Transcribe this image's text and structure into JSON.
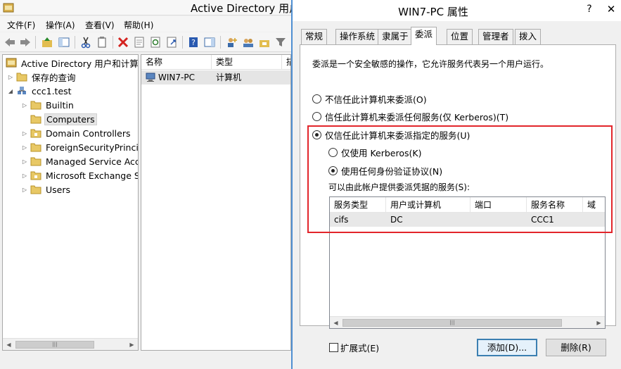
{
  "aduc": {
    "title": "Active Directory 用户",
    "menu": [
      "文件(F)",
      "操作(A)",
      "查看(V)",
      "帮助(H)"
    ],
    "tree": {
      "root": "Active Directory 用户和计算机",
      "saved_queries": "保存的查询",
      "domain": "ccc1.test",
      "children": [
        "Builtin",
        "Computers",
        "Domain Controllers",
        "ForeignSecurityPrincipals",
        "Managed Service Accounts",
        "Microsoft Exchange Security Groups",
        "Users"
      ],
      "selected": "Computers"
    },
    "list": {
      "columns": [
        "名称",
        "类型",
        "描"
      ],
      "rows": [
        {
          "name": "WIN7-PC",
          "type": "计算机"
        }
      ]
    }
  },
  "dialog": {
    "title": "WIN7-PC 属性",
    "help_glyph": "?",
    "close_glyph": "✕",
    "tabs": [
      "常规",
      "操作系统",
      "隶属于",
      "委派",
      "位置",
      "管理者",
      "拨入"
    ],
    "active_tab": "委派",
    "description": "委派是一个安全敏感的操作，它允许服务代表另一个用户运行。",
    "options": {
      "no_trust": "不信任此计算机来委派(O)",
      "trust_any": "信任此计算机来委派任何服务(仅 Kerberos)(T)",
      "trust_specified": "仅信任此计算机来委派指定的服务(U)",
      "kerberos_only": "仅使用 Kerberos(K)",
      "any_protocol": "使用任何身份验证协议(N)"
    },
    "selected_option": "trust_specified",
    "selected_protocol": "any_protocol",
    "services_label": "可以由此帐户提供委派凭据的服务(S):",
    "service_columns": [
      "服务类型",
      "用户或计算机",
      "端口",
      "服务名称",
      "域"
    ],
    "services": [
      {
        "type": "cifs",
        "user_or_computer": "DC",
        "port": "",
        "service_name": "CCC1",
        "domain": ""
      }
    ],
    "expanded_label": "扩展式(E)",
    "expanded_checked": false,
    "add_button": "添加(D)...",
    "remove_button": "删除(R)"
  },
  "colors": {
    "highlight": "#e2252b",
    "dialog_border": "#4f8fd2",
    "default_button_border": "#3c7fb1"
  }
}
